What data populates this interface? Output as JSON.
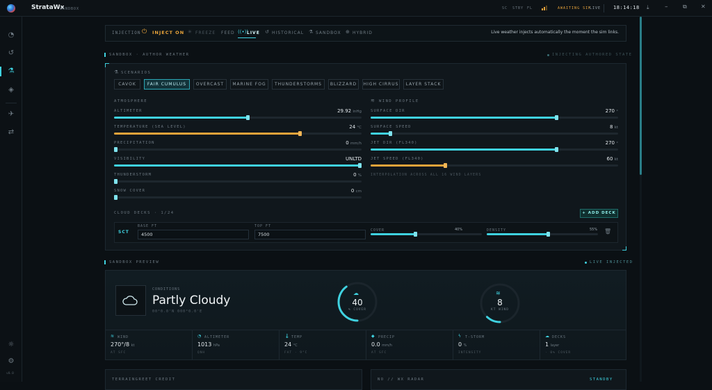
{
  "titlebar": {
    "app_name": "StrataWx",
    "app_mode": "SANDBOX",
    "indicators": [
      "SC",
      "STBY",
      "FL"
    ],
    "sim_status": "AWAITING SIM",
    "live_label": "LIVE",
    "clock": "18:14:18"
  },
  "sidebar": {
    "icons": [
      "gauge-icon",
      "history-icon",
      "flask-icon",
      "layers-icon",
      "plane-icon",
      "route-icon"
    ],
    "bottom_icons": [
      "sun-icon",
      "gear-icon"
    ],
    "version": "v0.0"
  },
  "tabs": {
    "injection_label": "INJECTION",
    "inject_on": "INJECT ON",
    "freeze": "FREEZE",
    "feed": "FEED",
    "live": "LIVE",
    "historical": "HISTORICAL",
    "sandbox": "SANDBOX",
    "hybrid": "HYBRID",
    "info": "Live weather injects automatically the moment the sim links."
  },
  "author": {
    "section_title": "SANDBOX · AUTHOR WEATHER",
    "section_status": "INJECTING AUTHORED STATE",
    "scenarios_label": "SCENARIOS",
    "scenarios": [
      "CAVOK",
      "FAIR CUMULUS",
      "OVERCAST",
      "MARINE FOG",
      "THUNDERSTORMS",
      "BLIZZARD",
      "HIGH CIRRUS",
      "LAYER STACK"
    ],
    "active_scenario": "FAIR CUMULUS",
    "atmosphere_label": "ATMOSPHERE",
    "atmosphere": [
      {
        "label": "ALTIMETER",
        "value": "29.92",
        "unit": "inHg",
        "level": 0.54,
        "color": "#3fd2e0"
      },
      {
        "label": "TEMPERATURE (SEA LEVEL)",
        "value": "24",
        "unit": "°C",
        "level": 0.75,
        "color": "#e8a33a"
      },
      {
        "label": "PRECIPITATION",
        "value": "0",
        "unit": "mm/h",
        "level": 0.0,
        "color": "#3fd2e0"
      },
      {
        "label": "VISIBILITY",
        "value": "UNLTD",
        "unit": "",
        "level": 1.0,
        "color": "#3fd2e0"
      },
      {
        "label": "THUNDERSTORM",
        "value": "0",
        "unit": "%",
        "level": 0.0,
        "color": "#3fd2e0"
      },
      {
        "label": "SNOW COVER",
        "value": "0",
        "unit": "cm",
        "level": 0.0,
        "color": "#3fd2e0"
      }
    ],
    "wind_label": "WIND PROFILE",
    "wind": [
      {
        "label": "SURFACE DIR",
        "value": "270",
        "unit": "°",
        "level": 0.75,
        "color": "#3fd2e0"
      },
      {
        "label": "SURFACE SPEED",
        "value": "8",
        "unit": "kt",
        "level": 0.08,
        "color": "#3fd2e0"
      },
      {
        "label": "JET DIR (FL340)",
        "value": "270",
        "unit": "°",
        "level": 0.75,
        "color": "#3fd2e0"
      },
      {
        "label": "JET SPEED (FL340)",
        "value": "60",
        "unit": "kt",
        "level": 0.3,
        "color": "#e8a33a"
      }
    ],
    "wind_note": "INTERPOLATION ACROSS ALL 16 WIND LAYERS",
    "cloud_decks_label": "CLOUD DECKS · 1/24",
    "add_deck": "+ ADD DECK",
    "deck": {
      "type": "SCT",
      "base_label": "BASE FT",
      "base_value": "4500",
      "top_label": "TOP FT",
      "top_value": "7500",
      "cover_label": "COVER",
      "cover_value": "40%",
      "cover_level": 0.4,
      "density_label": "DENSITY",
      "density_value": "55%",
      "density_level": 0.55
    }
  },
  "preview": {
    "section_title": "SANDBOX PREVIEW",
    "section_status": "LIVE INJECTED",
    "conditions_label": "CONDITIONS",
    "condition": "Partly Cloudy",
    "coords": "00°0.0'N 000°0.0'E",
    "cover_value": "40",
    "cover_label": "% COVER",
    "cover_level": 0.4,
    "wind_value": "8",
    "wind_label": "KT WIND",
    "wind_level": 0.1,
    "cards": [
      {
        "icon": "wind-icon",
        "label": "WIND",
        "value": "270°/8",
        "unit": "kt",
        "sub": "AT SFC"
      },
      {
        "icon": "gauge-icon",
        "label": "ALTIMETER",
        "value": "1013",
        "unit": "hPa",
        "sub": "QNH"
      },
      {
        "icon": "thermometer-icon",
        "label": "TEMP",
        "value": "24",
        "unit": "°C",
        "sub": "FAT · 9°C"
      },
      {
        "icon": "drop-icon",
        "label": "PRECIP",
        "value": "0.0",
        "unit": "mm/h",
        "sub": "AT SFC"
      },
      {
        "icon": "bolt-icon",
        "label": "T-STORM",
        "value": "0",
        "unit": "%",
        "sub": "INTENSITY"
      },
      {
        "icon": "cloud-icon",
        "label": "DECKS",
        "value": "1",
        "unit": "layer",
        "sub": "· 0% COVER"
      }
    ]
  },
  "bottom": {
    "left_title": "TERRAINGREET CREDIT",
    "right_title": "NO // WX RADAR",
    "right_status": "STANDBY"
  },
  "colors": {
    "accent": "#3fd2e0",
    "warn": "#e8a33a",
    "bg": "#0b1014"
  }
}
